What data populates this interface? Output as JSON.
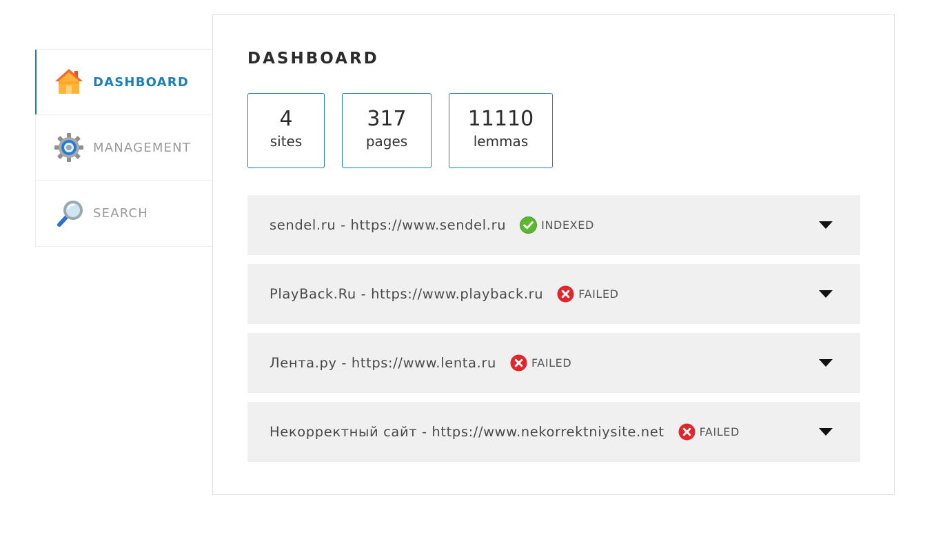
{
  "sidebar": {
    "items": [
      {
        "label": "DASHBOARD",
        "icon": "home-icon",
        "active": true
      },
      {
        "label": "MANAGEMENT",
        "icon": "gear-icon",
        "active": false
      },
      {
        "label": "SEARCH",
        "icon": "magnifier-icon",
        "active": false
      }
    ]
  },
  "main": {
    "title": "DASHBOARD",
    "stats": [
      {
        "value": "4",
        "label": "sites"
      },
      {
        "value": "317",
        "label": "pages"
      },
      {
        "value": "11110",
        "label": "lemmas"
      }
    ],
    "sites": [
      {
        "text": "sendel.ru - https://www.sendel.ru",
        "status": "INDEXED"
      },
      {
        "text": "PlayBack.Ru - https://www.playback.ru",
        "status": "FAILED"
      },
      {
        "text": "Лента.ру - https://www.lenta.ru",
        "status": "FAILED"
      },
      {
        "text": "Некорректный сайт - https://www.nekorrektniysite.net",
        "status": "FAILED"
      }
    ]
  },
  "colors": {
    "accent": "#1e7eb8",
    "indexed": "#5cb82e",
    "failed": "#e0262b",
    "row_bg": "#f0f0f0"
  }
}
